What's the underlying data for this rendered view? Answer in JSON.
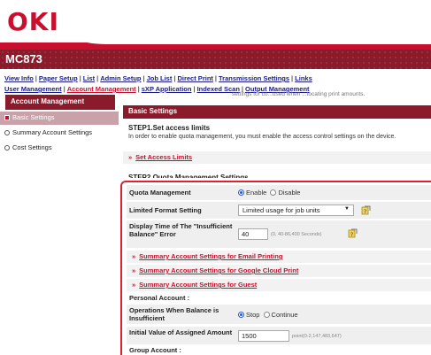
{
  "brand": {
    "logo": "OKI",
    "model": "MC873"
  },
  "nav": {
    "row1": [
      "View Info",
      "Paper Setup",
      "List",
      "Admin Setup",
      "Job List",
      "Direct Print",
      "Transmission Settings",
      "Links"
    ],
    "row2": [
      "User Management",
      "Account Management",
      "sXP Application",
      "Indexed Scan",
      "Output Management"
    ],
    "ghost": "settings for co...used when ...tocating print amounts."
  },
  "sidebar": {
    "title": "Account Management",
    "items": [
      {
        "label": "Basic Settings",
        "selected": true
      },
      {
        "label": "Summary Account Settings",
        "selected": false
      },
      {
        "label": "Cost Settings",
        "selected": false
      }
    ]
  },
  "main": {
    "title": "Basic Settings",
    "step1": {
      "title": "STEP1.Set access limits",
      "desc": "In order to enable quota management, you must enable the access control settings on the device.",
      "link": "Set Access Limits"
    },
    "step2_title": "STEP2.Quota Management Settings",
    "quota": {
      "label": "Quota Management",
      "options": [
        "Enable",
        "Disable"
      ],
      "selected": "Enable"
    },
    "limited": {
      "label": "Limited Format Setting",
      "value": "Limited usage for job units"
    },
    "display_time": {
      "label": "Display Time of The \"Insufficient Balance\" Error",
      "value": "40",
      "hint": "(0, 40-86,400 Seconds)"
    },
    "links": [
      "Summary Account Settings for Email Printing",
      "Summary Account Settings for Google Cloud Print",
      "Summary Account Settings for Guest"
    ],
    "personal": "Personal Account :",
    "operations": {
      "label": "Operations When Balance is Insufficient",
      "options": [
        "Stop",
        "Continue"
      ],
      "selected": "Stop"
    },
    "initial": {
      "label": "Initial Value of Assigned Amount",
      "value": "1500",
      "hint": "point(0-2,147,483,647)"
    },
    "group": "Group Account :"
  },
  "colors": {
    "brand_red": "#c8102e",
    "bar_maroon": "#8b1a2b",
    "highlight": "#d9232f"
  }
}
